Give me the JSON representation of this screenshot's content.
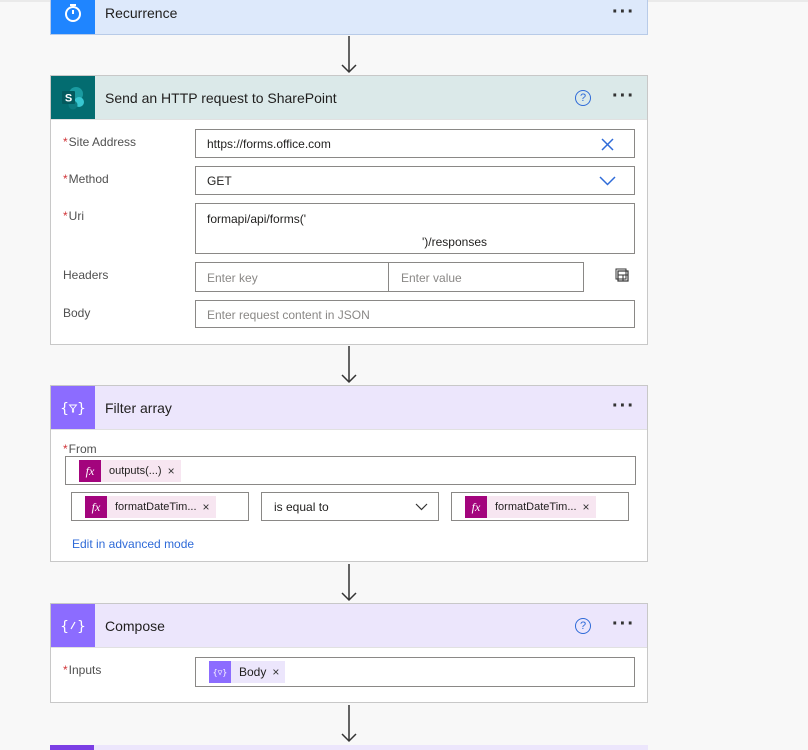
{
  "steps": {
    "recurrence": {
      "title": "Recurrence",
      "icon": "timer-icon",
      "color": "#1f85ff",
      "more": "···"
    },
    "http": {
      "title": "Send an HTTP request to SharePoint",
      "icon": "sharepoint-icon",
      "color": "#036c70",
      "help": "?",
      "more": "···",
      "fields": {
        "site_address": {
          "label": "Site Address",
          "value": "https://forms.office.com"
        },
        "method": {
          "label": "Method",
          "value": "GET"
        },
        "uri": {
          "label": "Uri",
          "line1": "formapi/api/forms('",
          "line2": "')/responses"
        },
        "headers": {
          "label": "Headers",
          "key_placeholder": "Enter key",
          "value_placeholder": "Enter value"
        },
        "body": {
          "label": "Body",
          "placeholder": "Enter request content in JSON"
        }
      }
    },
    "filter": {
      "title": "Filter array",
      "icon": "filter-array-icon",
      "color": "#8c6cff",
      "more": "···",
      "from_label": "From",
      "from_token": "outputs(...)",
      "left_token": "formatDateTim...",
      "operator": "is equal to",
      "right_token": "formatDateTim...",
      "advanced_link": "Edit in advanced mode"
    },
    "compose": {
      "title": "Compose",
      "icon": "compose-icon",
      "color": "#8c6cff",
      "help": "?",
      "more": "···",
      "inputs_label": "Inputs",
      "inputs_token": "Body"
    }
  },
  "required_marker": "*"
}
